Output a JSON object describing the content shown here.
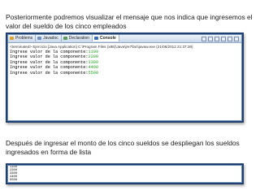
{
  "text1": "Posteriormente podremos visualizar el mensaje que nos indica que ingresemos el valor del sueldo de los cinco empleados",
  "text2": "Después de ingresar el monto de los cinco sueldos se despliegan los sueldos ingresados en forma de lista",
  "ide": {
    "tabs": [
      {
        "label": "Problems",
        "icon": "problems-icon",
        "color": "#d9a233"
      },
      {
        "label": "Javadoc",
        "icon": "javadoc-icon",
        "color": "#6c8fc2"
      },
      {
        "label": "Declaration",
        "icon": "declaration-icon",
        "color": "#5c9a5c"
      },
      {
        "label": "Console",
        "icon": "console-icon",
        "color": "#3b6db3"
      }
    ],
    "console_header": "<terminated> Ejercicio [Java Application] C:\\Program Files (x86)\\Java\\jre7\\bin\\javaw.exe (21/06/2012 21:37:28)",
    "prompt": "Ingrese valor de la componente:",
    "lines": [
      "1100",
      "2200",
      "3300",
      "4400",
      "5500"
    ]
  },
  "output": {
    "values": [
      "1100",
      "2200",
      "3300",
      "4400",
      "5500"
    ]
  }
}
